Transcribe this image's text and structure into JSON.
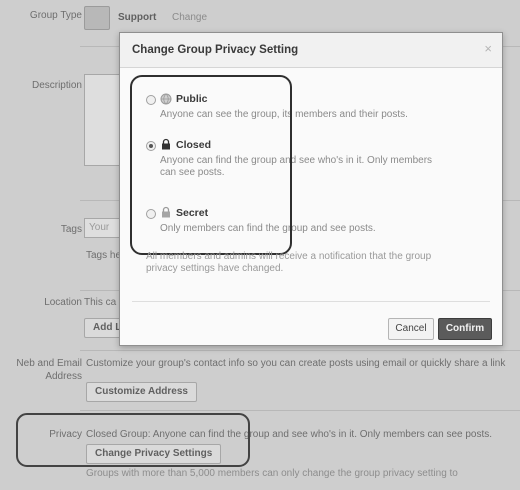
{
  "page": {
    "group_type": {
      "label": "Group Type",
      "value": "Support",
      "change_link": "Change"
    },
    "description": {
      "label": "Description"
    },
    "tags": {
      "label": "Tags",
      "input_placeholder": "Your",
      "hint": "Tags he"
    },
    "location": {
      "label": "Location",
      "text": "This ca",
      "button": "Add L"
    },
    "web_email": {
      "label_line1": "Neb and Email",
      "label_line2": "Address",
      "text": "Customize your group's contact info so you can create posts using email or quickly share a link",
      "button": "Customize Address"
    },
    "privacy": {
      "label": "Privacy",
      "text": "Closed Group: Anyone can find the group and see who's in it. Only members can see posts.",
      "button": "Change Privacy Settings",
      "footnote": "Groups with more than 5,000 members can only change the group privacy setting to"
    }
  },
  "modal": {
    "title": "Change Group Privacy Setting",
    "close_symbol": "×",
    "options": [
      {
        "title": "Public",
        "description": "Anyone can see the group, its members and their posts.",
        "selected": false,
        "icon": "globe-icon"
      },
      {
        "title": "Closed",
        "description_line1": "Anyone can find the group and see who's in it. Only members",
        "description_line2": "can see posts.",
        "selected": true,
        "icon": "lock-icon"
      },
      {
        "title": "Secret",
        "description": "Only members can find the group and see posts.",
        "selected": false,
        "icon": "lock-icon"
      }
    ],
    "notice_line1": "All members and admins will receive a notification that the group",
    "notice_line2": "privacy settings have changed.",
    "cancel": "Cancel",
    "confirm": "Confirm"
  }
}
